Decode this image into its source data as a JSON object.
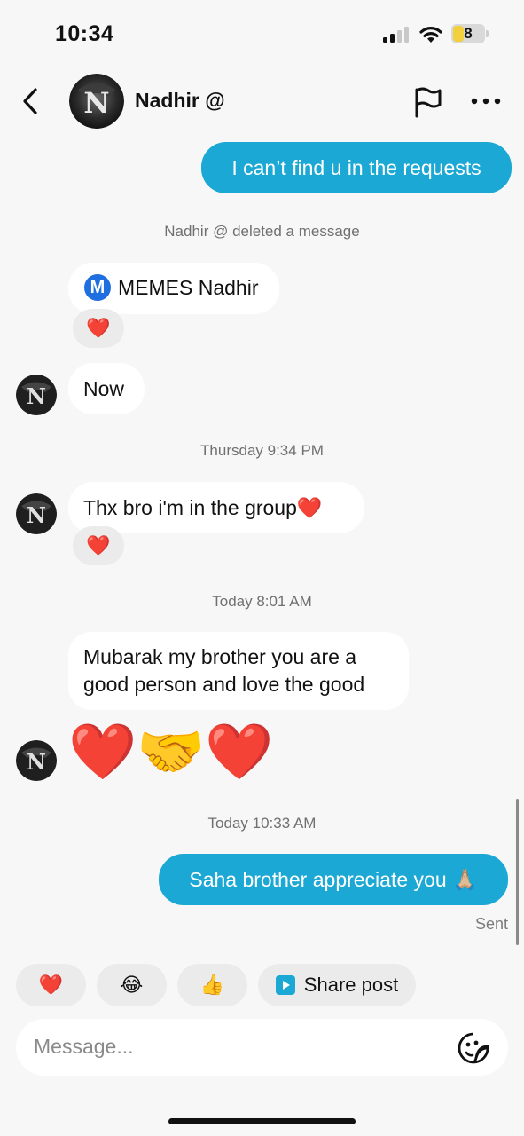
{
  "status_bar": {
    "time": "10:34",
    "battery_level": "8"
  },
  "header": {
    "contact_name": "Nadhir @",
    "avatar_letter": "N"
  },
  "messages": {
    "m1": "I can’t find u in the requests",
    "deleted_notice": "Nadhir @ deleted a message",
    "m2_badge": "M",
    "m2": "MEMES Nadhir",
    "m2_reaction": "❤️",
    "m3": "Now",
    "ts1": "Thursday 9:34 PM",
    "m4": "Thx bro i'm in the group❤️",
    "m4_reaction": "❤️",
    "ts2": "Today 8:01 AM",
    "m5_line1": "Mubarak my brother you are a",
    "m5_line2": "good person and love the good",
    "m6_emojis": "❤️🤝❤️",
    "ts3": "Today 10:33 AM",
    "m7": "Saha brother appreciate you 🙏🏼",
    "sent_status": "Sent"
  },
  "quick_replies": {
    "heart": "❤️",
    "laugh": "😂",
    "thumbs": "👍",
    "share_post": "Share post"
  },
  "composer": {
    "placeholder": "Message..."
  },
  "colors": {
    "outgoing_bubble": "#1ba8d4",
    "incoming_bubble": "#ffffff",
    "background": "#f7f7f7"
  }
}
